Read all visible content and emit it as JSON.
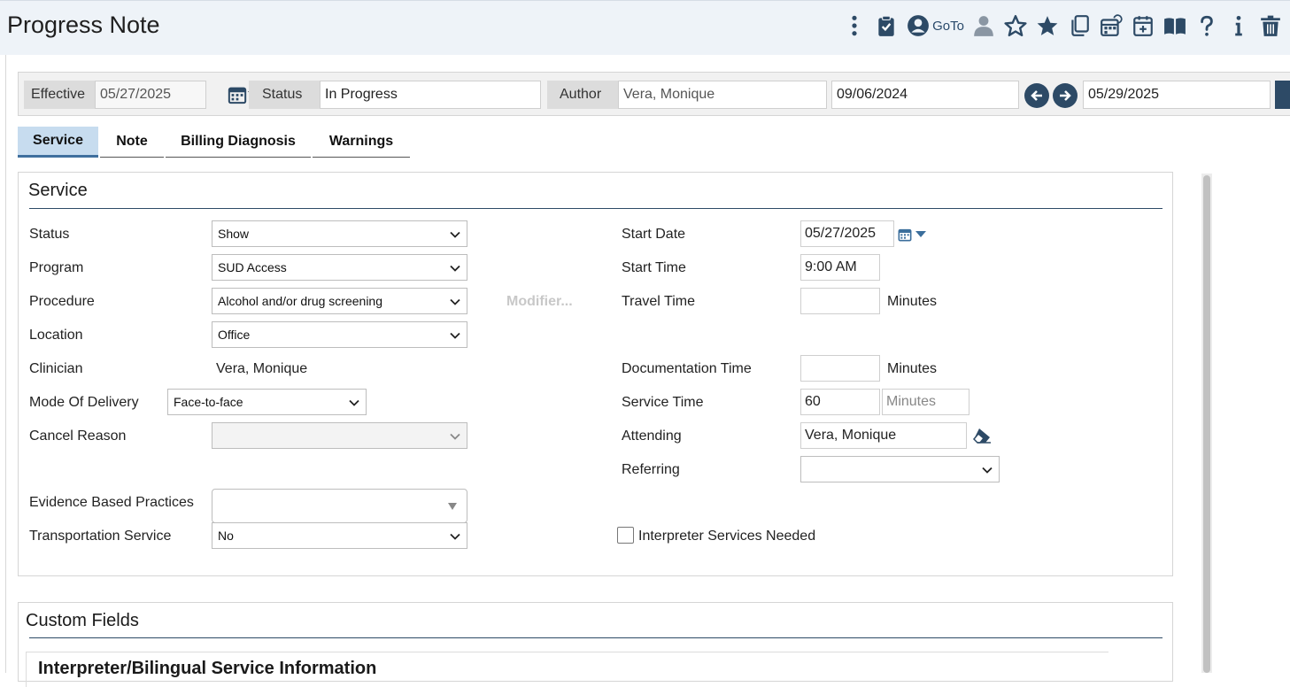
{
  "header": {
    "title": "Progress Note",
    "goto_label": "GoTo",
    "icons": [
      "more-vertical-icon",
      "clipboard-check-icon",
      "user-circle-icon",
      "person-icon",
      "star-outline-icon",
      "star-filled-icon",
      "copy-icon",
      "calendar-refresh-icon",
      "calendar-plus-icon",
      "book-open-icon",
      "help-icon",
      "info-icon",
      "trash-icon"
    ]
  },
  "infobar": {
    "effective_label": "Effective",
    "effective_value": "05/27/2025",
    "status_label": "Status",
    "status_value": "In Progress",
    "author_label": "Author",
    "author_value": "Vera, Monique",
    "date_from": "09/06/2024",
    "date_to": "05/29/2025"
  },
  "tabs": [
    {
      "label": "Service",
      "active": true
    },
    {
      "label": "Note",
      "active": false
    },
    {
      "label": "Billing Diagnosis",
      "active": false
    },
    {
      "label": "Warnings",
      "active": false
    }
  ],
  "service": {
    "title": "Service",
    "status_label": "Status",
    "status_value": "Show",
    "program_label": "Program",
    "program_value": "SUD Access",
    "procedure_label": "Procedure",
    "procedure_value": "Alcohol and/or drug screening",
    "modifier_label": "Modifier...",
    "location_label": "Location",
    "location_value": "Office",
    "clinician_label": "Clinician",
    "clinician_value": "Vera, Monique",
    "mode_label": "Mode Of Delivery",
    "mode_value": "Face-to-face",
    "cancel_reason_label": "Cancel Reason",
    "cancel_reason_value": "",
    "ebp_label": "Evidence Based Practices",
    "ebp_value": "",
    "transport_label": "Transportation Service",
    "transport_value": "No",
    "start_date_label": "Start Date",
    "start_date_value": "05/27/2025",
    "start_time_label": "Start Time",
    "start_time_value": "9:00 AM",
    "travel_time_label": "Travel Time",
    "travel_time_value": "",
    "minutes_label": "Minutes",
    "doc_time_label": "Documentation Time",
    "doc_time_value": "",
    "service_time_label": "Service Time",
    "service_time_value": "60",
    "service_time_unit": "Minutes",
    "attending_label": "Attending",
    "attending_value": "Vera, Monique",
    "referring_label": "Referring",
    "referring_value": "",
    "interpreter_label": "Interpreter Services Needed",
    "interpreter_checked": false
  },
  "custom_fields": {
    "title": "Custom Fields",
    "subsection_title": "Interpreter/Bilingual Service Information"
  },
  "colors": {
    "accent": "#2d4a66",
    "tab_active_bg": "#c7dcef",
    "header_bg": "#eef3f8"
  }
}
